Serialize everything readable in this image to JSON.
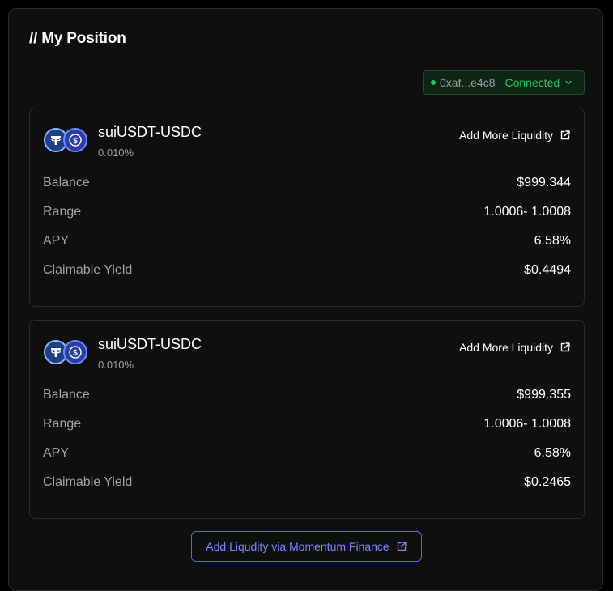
{
  "header": {
    "title": "// My Position"
  },
  "wallet": {
    "address": "0xaf...e4c8",
    "status": "Connected",
    "status_color": "#22c55e",
    "icon": "chevron-down-icon"
  },
  "positions": [
    {
      "pair": "suiUSDT-USDC",
      "fee": "0.010%",
      "action_label": "Add More Liquidity",
      "tokens": [
        "usdt-icon",
        "usdc-icon"
      ],
      "rows": [
        {
          "label": "Balance",
          "value": "$999.344"
        },
        {
          "label": "Range",
          "value": "1.0006- 1.0008"
        },
        {
          "label": "APY",
          "value": "6.58%"
        },
        {
          "label": "Claimable Yield",
          "value": "$0.4494"
        }
      ]
    },
    {
      "pair": "suiUSDT-USDC",
      "fee": "0.010%",
      "action_label": "Add More Liquidity",
      "tokens": [
        "usdt-icon",
        "usdc-icon"
      ],
      "rows": [
        {
          "label": "Balance",
          "value": "$999.355"
        },
        {
          "label": "Range",
          "value": "1.0006- 1.0008"
        },
        {
          "label": "APY",
          "value": "6.58%"
        },
        {
          "label": "Claimable Yield",
          "value": "$0.2465"
        }
      ]
    }
  ],
  "footer": {
    "momentum_label": "Add Liqudity via Momentum Finance",
    "accent_color": "#5b63f5"
  }
}
